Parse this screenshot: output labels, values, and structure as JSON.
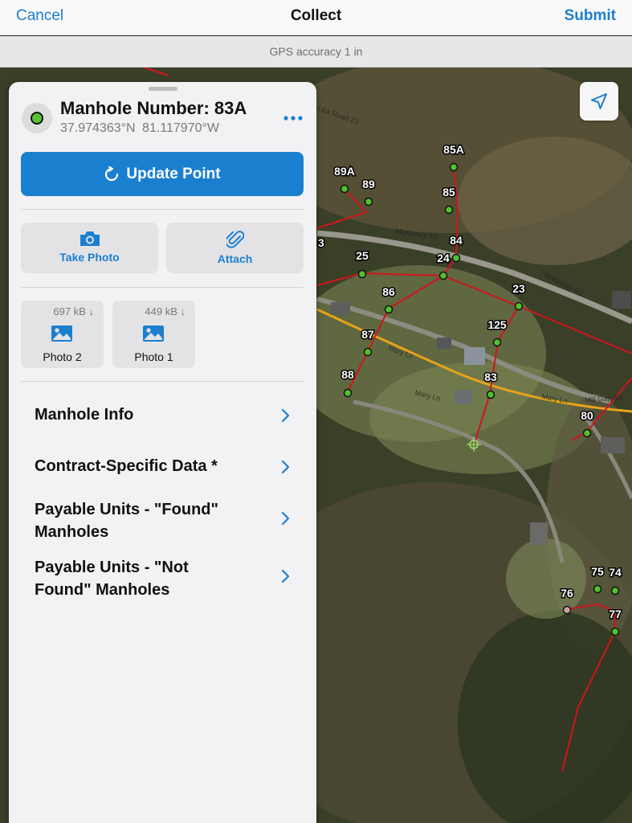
{
  "nav": {
    "cancel_label": "Cancel",
    "title": "Collect",
    "submit_label": "Submit"
  },
  "gps": {
    "accuracy_text": "GPS accuracy 1 in"
  },
  "feature": {
    "title": "Manhole Number: 83A",
    "latitude": "37.974363°N",
    "longitude": "81.117970°W",
    "status_color": "#5bc236"
  },
  "buttons": {
    "update_point": "Update Point",
    "take_photo": "Take Photo",
    "attach": "Attach"
  },
  "attachments": [
    {
      "name": "Photo 2",
      "size": "697 kB ↓"
    },
    {
      "name": "Photo 1",
      "size": "449 kB ↓"
    }
  ],
  "sections": [
    {
      "label": "Manhole Info"
    },
    {
      "label": "Contract-Specific Data *"
    },
    {
      "label": "Payable Units - \"Found\" Manholes"
    },
    {
      "label": "Payable Units - \"Not Found\" Manholes"
    }
  ],
  "map": {
    "accent_color": "#1b7fd0",
    "sewer_line_color": "#d3141c",
    "road_line_color": "#e8a21a",
    "manhole_point_color": "#4fc12e",
    "road_labels": [
      "McKinney Trl",
      "McKinney Rd",
      "Mary Ln",
      "Mary Ln",
      "Mary Ln",
      "Mill Gap Rd",
      "Lick Road 23"
    ],
    "manholes": [
      "85A",
      "89A",
      "89",
      "85",
      "84",
      "25",
      "24",
      "86",
      "23",
      "125",
      "87",
      "83",
      "88",
      "80",
      "75",
      "74",
      "76",
      "77"
    ],
    "partial_label": "3"
  },
  "icons": {
    "locate": "location-arrow-icon",
    "update": "refresh-icon",
    "camera": "camera-icon",
    "attach": "paperclip-icon",
    "photo": "image-icon",
    "more": "ellipsis-icon",
    "chevron": "chevron-right-icon"
  }
}
